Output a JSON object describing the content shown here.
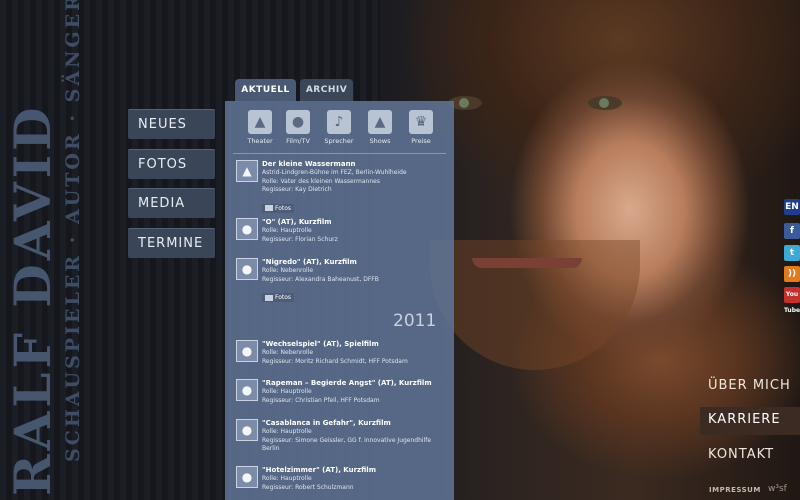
{
  "brand": {
    "name": "RALF DAVID",
    "tagline": "SCHAUSPIELER · AUTOR · SÄNGER"
  },
  "nav": {
    "items": [
      {
        "label": "NEUES"
      },
      {
        "label": "FOTOS"
      },
      {
        "label": "MEDIA"
      },
      {
        "label": "TERMINE"
      }
    ]
  },
  "tabs": [
    {
      "label": "AKTUELL",
      "active": true
    },
    {
      "label": "ARCHIV",
      "active": false
    }
  ],
  "categories": [
    {
      "label": "Theater",
      "icon": "theater-icon"
    },
    {
      "label": "Film/TV",
      "icon": "film-camera-icon"
    },
    {
      "label": "Sprecher",
      "icon": "microphone-icon"
    },
    {
      "label": "Shows",
      "icon": "spotlight-icon"
    },
    {
      "label": "Preise",
      "icon": "trophy-icon"
    }
  ],
  "entries_top": [
    {
      "icon": "theater-icon",
      "title": "Der kleine Wassermann",
      "lines": [
        "Astrid-Lindgren-Bühne im FEZ, Berlin-Wuhlheide",
        "Rolle: Vater des kleinen Wassermannes",
        "Regisseur: Kay Dietrich"
      ],
      "fotos": "Fotos"
    },
    {
      "icon": "film-camera-icon",
      "title": "\"O\" (AT), Kurzfilm",
      "lines": [
        "Rolle: Hauptrolle",
        "Regisseur: Florian Schurz"
      ]
    },
    {
      "icon": "film-camera-icon",
      "title": "\"Nigredo\" (AT), Kurzfilm",
      "lines": [
        "Rolle: Nebenrolle",
        "Regisseur: Alexandra Baheanust, DFFB"
      ],
      "fotos": "Fotos"
    }
  ],
  "year": "2011",
  "entries_2011": [
    {
      "icon": "film-camera-icon",
      "title": "\"Wechselspiel\" (AT), Spielfilm",
      "lines": [
        "Rolle: Nebenrolle",
        "Regisseur: Moritz Richard Schmidt, HFF Potsdam"
      ]
    },
    {
      "icon": "film-camera-icon",
      "title": "\"Rapeman – Begierde Angst\" (AT), Kurzfilm",
      "lines": [
        "Rolle: Hauptrolle",
        "Regisseur: Christian Pfeil, HFF Potsdam"
      ]
    },
    {
      "icon": "film-camera-icon",
      "title": "\"Casablanca in Gefahr\", Kurzfilm",
      "lines": [
        "Rolle: Hauptrolle",
        "Regisseur: Simone Geissler, GG f. innovative Jugendhilfe",
        "Berlin"
      ]
    },
    {
      "icon": "film-camera-icon",
      "title": "\"Hotelzimmer\" (AT), Kurzfilm",
      "lines": [
        "Rolle: Hauptrolle",
        "Regisseur: Robert Schulzmann"
      ]
    }
  ],
  "social": {
    "english": "EN",
    "facebook": "f",
    "twitter": "t",
    "rss": "))",
    "youtube": "You Tube"
  },
  "right_nav": {
    "about": "ÜBER MICH",
    "career": "KARRIERE",
    "contact": "KONTAKT"
  },
  "footer": {
    "impressum": "IMPRESSUM",
    "credit": "w³sf"
  },
  "colors": {
    "panel": "#5f7394",
    "nav_button": "#3a4558",
    "brand_text": "#47566f",
    "active_right_nav": "#3b2b22"
  }
}
